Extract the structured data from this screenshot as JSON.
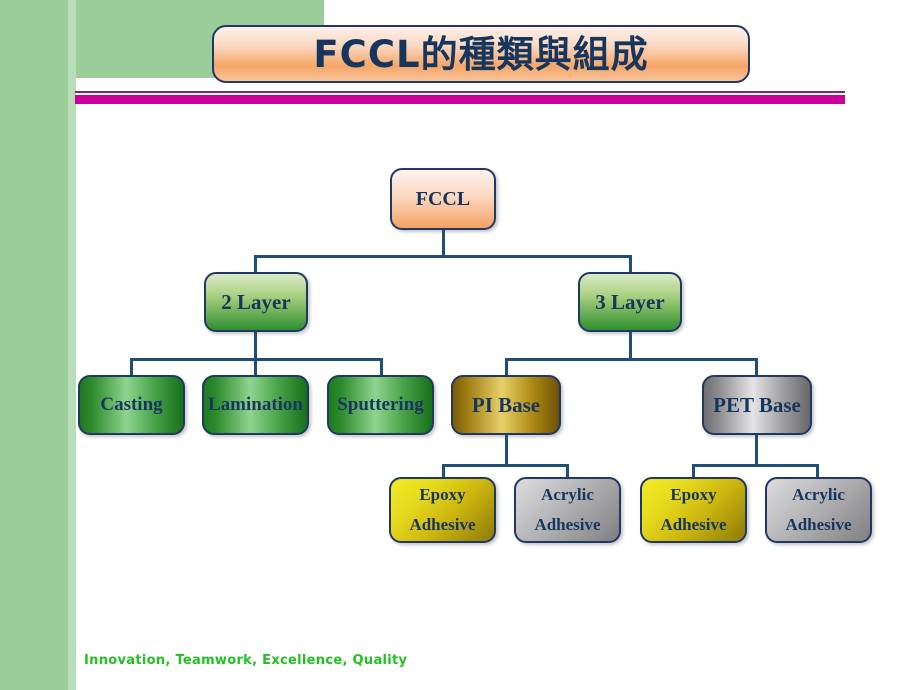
{
  "slide": {
    "title": "FCCL的種類與組成",
    "footer": "Innovation,  Teamwork,  Excellence, Quality",
    "accent_colors": {
      "background_green": "#9acd9a",
      "rule_magenta": "#cc0099",
      "rule_purple": "#7b2d6b",
      "node_text": "#17365d",
      "connector": "#1f4e79",
      "footer_green": "#22c022"
    }
  },
  "chart_data": {
    "type": "diagram",
    "title": "FCCL的種類與組成",
    "layout": "top-down tree",
    "nodes": [
      {
        "id": "fccl",
        "label": "FCCL",
        "level": 0,
        "style": "peach"
      },
      {
        "id": "two_layer",
        "label": "2 Layer",
        "level": 1,
        "style": "green-vertical"
      },
      {
        "id": "three_layer",
        "label": "3 Layer",
        "level": 1,
        "style": "green-vertical"
      },
      {
        "id": "casting",
        "label": "Casting",
        "level": 2,
        "style": "green"
      },
      {
        "id": "lamination",
        "label": "Lamination",
        "level": 2,
        "style": "green"
      },
      {
        "id": "sputtering",
        "label": "Sputtering",
        "level": 2,
        "style": "green"
      },
      {
        "id": "pi_base",
        "label": "PI Base",
        "level": 2,
        "style": "gold"
      },
      {
        "id": "pet_base",
        "label": "PET Base",
        "level": 2,
        "style": "silver"
      },
      {
        "id": "pi_epoxy",
        "label_line1": "Epoxy",
        "label_line2": "Adhesive",
        "level": 3,
        "style": "yellow"
      },
      {
        "id": "pi_acrylic",
        "label_line1": "Acrylic",
        "label_line2": "Adhesive",
        "level": 3,
        "style": "gray"
      },
      {
        "id": "pet_epoxy",
        "label_line1": "Epoxy",
        "label_line2": "Adhesive",
        "level": 3,
        "style": "yellow"
      },
      {
        "id": "pet_acrylic",
        "label_line1": "Acrylic",
        "label_line2": "Adhesive",
        "level": 3,
        "style": "gray"
      }
    ],
    "edges": [
      [
        "fccl",
        "two_layer"
      ],
      [
        "fccl",
        "three_layer"
      ],
      [
        "two_layer",
        "casting"
      ],
      [
        "two_layer",
        "lamination"
      ],
      [
        "two_layer",
        "sputtering"
      ],
      [
        "three_layer",
        "pi_base"
      ],
      [
        "three_layer",
        "pet_base"
      ],
      [
        "pi_base",
        "pi_epoxy"
      ],
      [
        "pi_base",
        "pi_acrylic"
      ],
      [
        "pet_base",
        "pet_epoxy"
      ],
      [
        "pet_base",
        "pet_acrylic"
      ]
    ]
  }
}
